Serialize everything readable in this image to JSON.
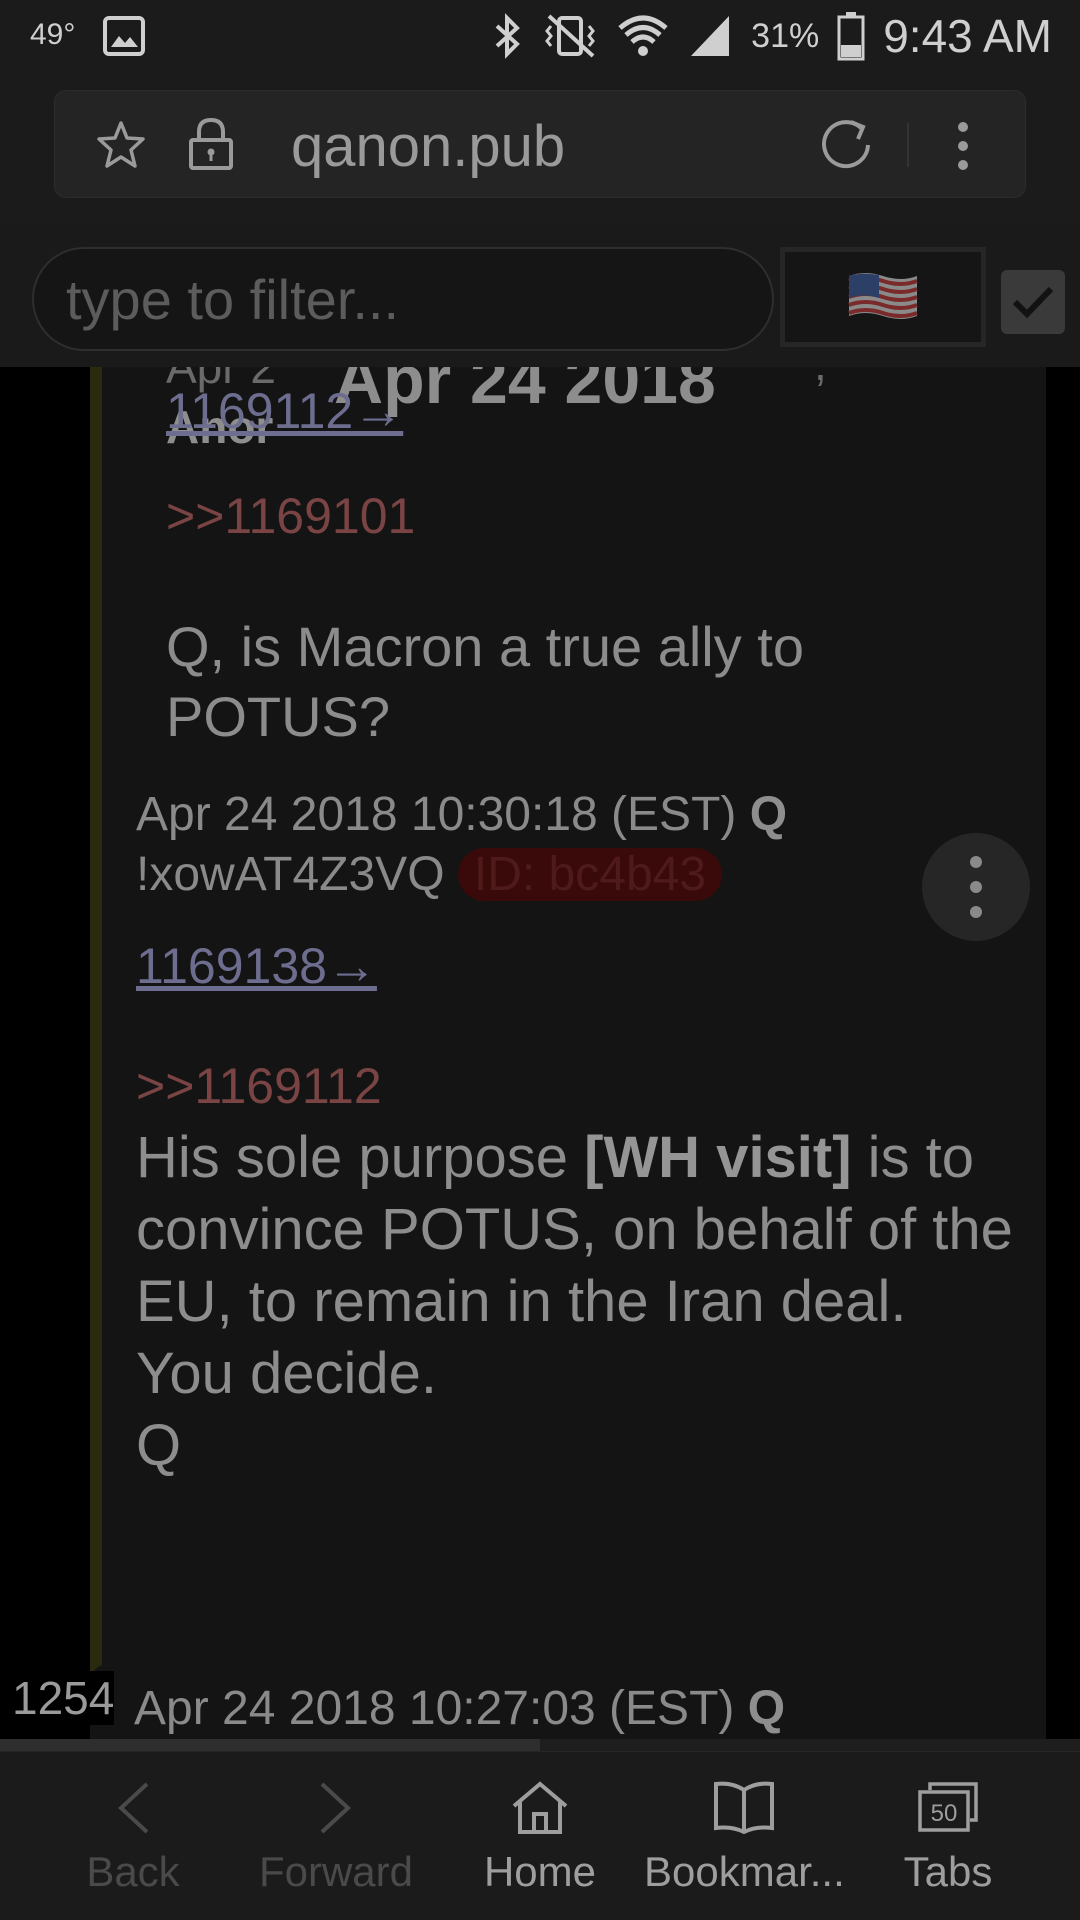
{
  "status_bar": {
    "temperature": "49°",
    "battery_percent": "31%",
    "battery_level": 0.31,
    "time": "9:43 AM",
    "icons": [
      "gallery-icon",
      "bluetooth-icon",
      "vibrate-icon",
      "wifi-icon",
      "signal-icon",
      "battery-icon"
    ]
  },
  "browser": {
    "url": "qanon.pub",
    "icons": [
      "star-icon",
      "lock-icon",
      "reload-icon",
      "more-vert-icon"
    ]
  },
  "filter": {
    "placeholder": "type to filter...",
    "flag_emoji": "🇺🇸",
    "checkbox_checked": true
  },
  "date_header": "Apr 24 2018",
  "quoted_post": {
    "author_truncated": "Anor",
    "date_cut": "Apr 2",
    "cut_comma": ",",
    "post_number_link": "1169112→",
    "reply_to": ">>1169101",
    "body": "Q, is Macron a true ally to POTUS?"
  },
  "q_post": {
    "timestamp": "Apr 24 2018 10:30:18 (EST)",
    "name": "Q",
    "tripcode": "!xowAT4Z3VQ",
    "id_badge": "ID: bc4b43",
    "post_number_link": "1169138→",
    "reply_to": ">>1169112",
    "body_prefix": "His sole purpose ",
    "body_bold": "[WH visit]",
    "body_suffix": " is to convince POTUS, on behalf of the EU, to remain in the Iran deal.\nYou decide.\nQ"
  },
  "next_post": {
    "counter": "1254",
    "timestamp": "Apr 24 2018 10:27:03 (EST)",
    "name": "Q"
  },
  "scroll_progress": 0.5,
  "bottom_nav": [
    {
      "label": "Back",
      "enabled": false
    },
    {
      "label": "Forward",
      "enabled": false
    },
    {
      "label": "Home",
      "enabled": true
    },
    {
      "label": "Bookmar...",
      "enabled": true
    },
    {
      "label": "Tabs",
      "enabled": true,
      "badge": "50"
    }
  ]
}
